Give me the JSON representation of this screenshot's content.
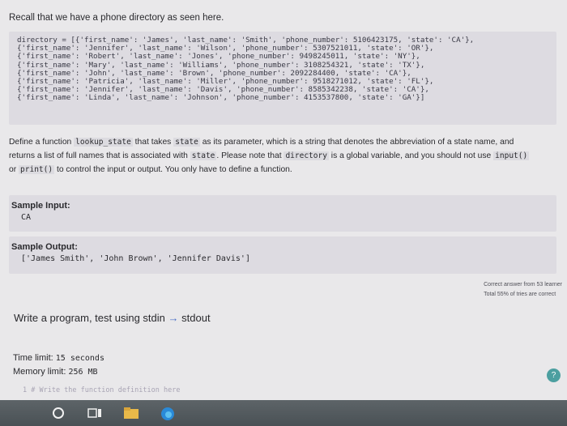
{
  "intro": "Recall that we have a phone directory as seen here.",
  "code_lines": [
    "directory = [{'first_name': 'James', 'last_name': 'Smith', 'phone_number': 5106423175, 'state': 'CA'},",
    "{'first_name': 'Jennifer', 'last_name': 'Wilson', 'phone_number': 5307521011, 'state': 'OR'},",
    "{'first_name': 'Robert', 'last_name': 'Jones', 'phone_number': 9498245011, 'state': 'NY'},",
    "{'first_name': 'Mary', 'last_name': 'Williams', 'phone_number': 3108254321, 'state': 'TX'},",
    "{'first_name': 'John', 'last_name': 'Brown', 'phone_number': 2092284400, 'state': 'CA'},",
    "{'first_name': 'Patricia', 'last_name': 'Miller', 'phone_number': 9518271012, 'state': 'FL'},",
    "{'first_name': 'Jennifer', 'last_name': 'Davis', 'phone_number': 8585342238, 'state': 'CA'},",
    "{'first_name': 'Linda', 'last_name': 'Johnson', 'phone_number': 4153537800, 'state': 'GA'}]"
  ],
  "desc": {
    "p1": "Define a function",
    "fn": "lookup_state",
    "p2": "that takes",
    "arg": "state",
    "p3": "as its parameter, which is a string that denotes the abbreviation of a state name, and",
    "p4": "returns a list of full names that is associated with",
    "arg2": "state",
    "p5": ". Please note that",
    "var": "directory",
    "p6": "is a global variable, and you should not use",
    "inp": "input()",
    "p7": "or",
    "prt": "print()",
    "p8": "to control the input or output. You only have to define a function."
  },
  "sample_input": {
    "label": "Sample Input:",
    "value": "CA"
  },
  "sample_output": {
    "label": "Sample Output:",
    "value": "['James Smith', 'John Brown', 'Jennifer Davis']"
  },
  "stats": {
    "line1": "Correct answer from 53 learner",
    "line2": "Total 55% of tries are correct"
  },
  "write_program": {
    "text": "Write a program, test using stdin",
    "arrow": "→",
    "text2": "stdout"
  },
  "limits": {
    "time_label": "Time limit:",
    "time_value": "15 seconds",
    "mem_label": "Memory limit:",
    "mem_value": "256 MB"
  },
  "editor_placeholder": "1 # Write the function definition here",
  "colors": {
    "background": "#e9e8ea",
    "code_bg": "#dddbe1",
    "taskbar": "#4f5659",
    "accent": "#4a6fc8"
  }
}
